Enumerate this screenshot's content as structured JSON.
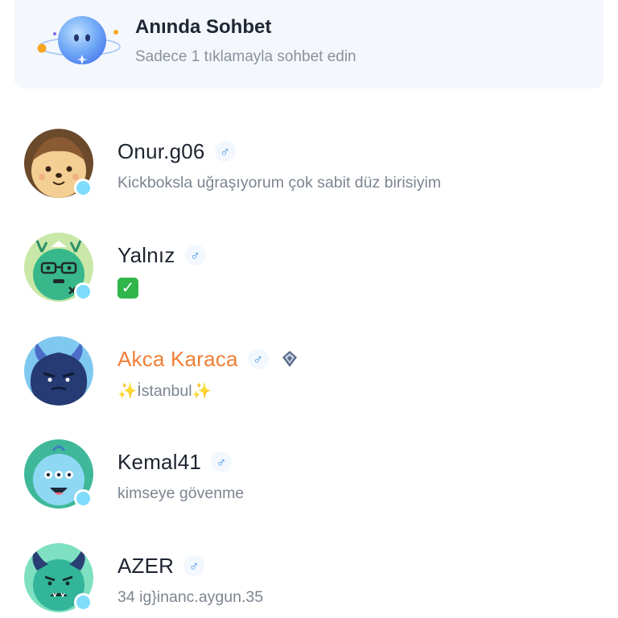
{
  "banner": {
    "title": "Anında Sohbet",
    "subtitle": "Sadece 1 tıklamayla sohbet edin",
    "icon": "chat-planet-mascot-icon"
  },
  "users": [
    {
      "name": "Onur.g06",
      "gender_symbol": "♂",
      "bio": "Kickboksla uğraşıyorum çok sabit düz birisiyim",
      "avatar": "hedgehog-avatar",
      "online": true
    },
    {
      "name": "Yalnız",
      "gender_symbol": "♂",
      "bio": "✓",
      "avatar": "green-monster-glasses-avatar",
      "online": true
    },
    {
      "name": "Akca Karaca",
      "gender_symbol": "♂",
      "bio_prefix": "✨",
      "bio_text": "İstanbul",
      "bio_suffix": "✨",
      "avatar": "navy-monster-horns-avatar",
      "online": false,
      "vip": true,
      "badge": "diamond-badge-icon"
    },
    {
      "name": "Kemal41",
      "gender_symbol": "♂",
      "bio": "kimseye  gövenme",
      "avatar": "blue-three-eyed-monster-avatar",
      "online": true
    },
    {
      "name": "AZER",
      "gender_symbol": "♂",
      "bio": "34  ig}inanc.aygun.35",
      "avatar": "teal-monster-horns-avatar",
      "online": true
    }
  ],
  "colors": {
    "vip_name": "#f07f36",
    "gender_male": "#3c8ee8",
    "online_dot": "#7fdcfb",
    "banner_bg": "#f4f7fc"
  }
}
